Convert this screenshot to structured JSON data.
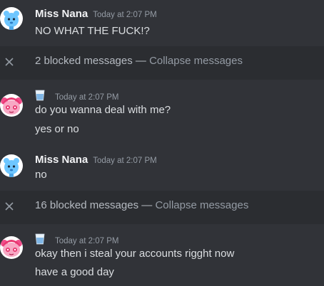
{
  "messages": [
    {
      "author": "Miss Nana",
      "timestamp": "Today at 2:07 PM",
      "lines": [
        "NO WHAT THE FUCK!?"
      ],
      "avatar": "blue-bear-avatar"
    },
    {
      "blocked_count_text": "2 blocked messages",
      "separator": " — ",
      "collapse_label": "Collapse messages"
    },
    {
      "header_icon": "glass-of-water-icon",
      "timestamp": "Today at 2:07 PM",
      "lines": [
        "do you wanna deal with me?",
        "yes or no"
      ],
      "avatar": "pink-character-avatar"
    },
    {
      "author": "Miss Nana",
      "timestamp": "Today at 2:07 PM",
      "lines": [
        "no"
      ],
      "avatar": "blue-bear-avatar"
    },
    {
      "blocked_count_text": "16 blocked messages",
      "separator": " — ",
      "collapse_label": "Collapse messages"
    },
    {
      "header_icon": "glass-of-water-icon",
      "timestamp": "Today at 2:07 PM",
      "lines": [
        "okay then i steal your accounts rigght now",
        "have a good day"
      ],
      "avatar": "pink-character-avatar"
    }
  ],
  "colors": {
    "background": "#313338",
    "blocked_bar": "#2b2d31",
    "username": "#f2f3f5",
    "text": "#dbdee1",
    "muted": "#949ba4"
  }
}
